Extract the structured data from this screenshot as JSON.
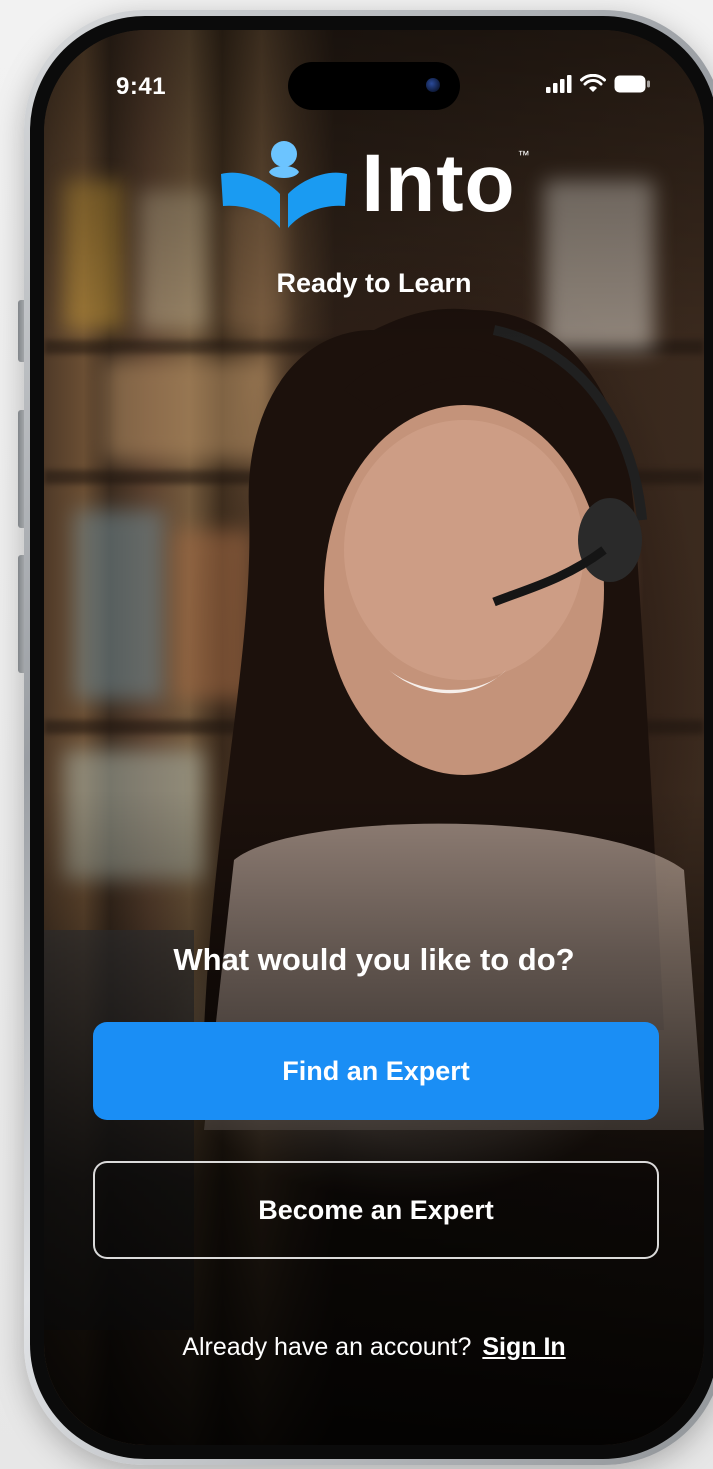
{
  "status_bar": {
    "time": "9:41",
    "icons": [
      "signal-icon",
      "wifi-icon",
      "battery-icon"
    ]
  },
  "brand": {
    "name": "Into",
    "trademark": "™",
    "tagline": "Ready to Learn",
    "logo_icon": "person-book-logo",
    "colors": {
      "logo_blue": "#1a9bf2",
      "logo_light_blue": "#6cc4ff"
    }
  },
  "prompt": {
    "question": "What would you like to do?"
  },
  "actions": {
    "find_expert_label": "Find an Expert",
    "become_expert_label": "Become an Expert",
    "primary_color": "#1a8ef5"
  },
  "signin": {
    "text": "Already have an account?",
    "link_label": "Sign In"
  }
}
